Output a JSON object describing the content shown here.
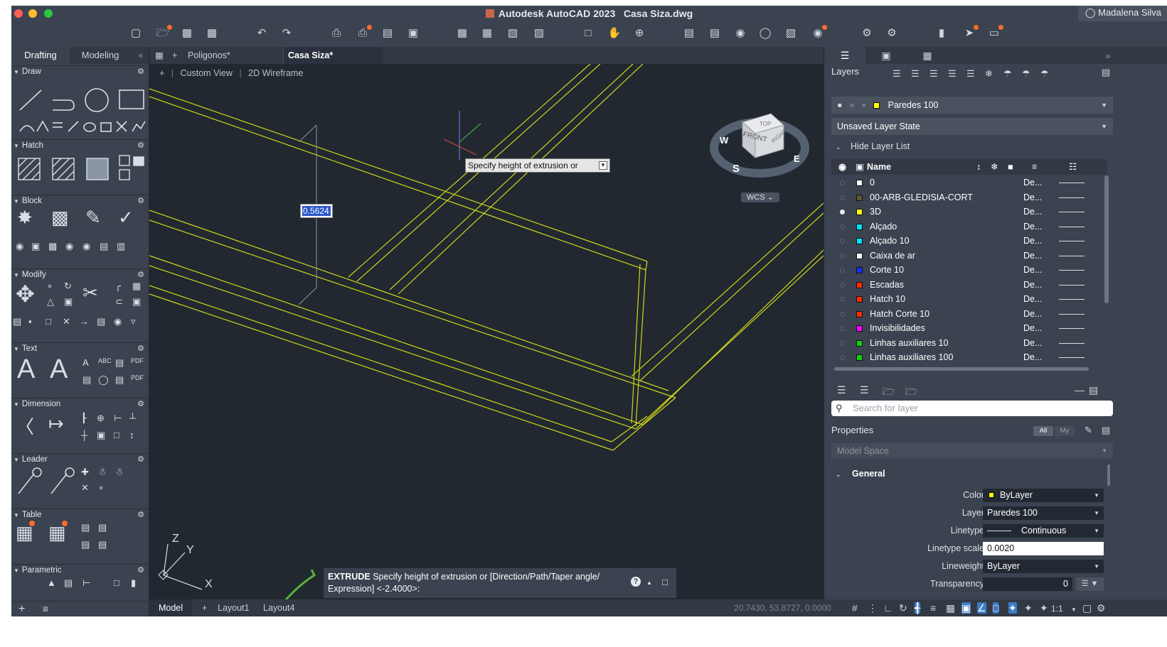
{
  "window": {
    "title_app": "Autodesk AutoCAD 2023",
    "title_doc": "Casa Siza.dwg",
    "user": "Madalena Silva"
  },
  "toolbar_icons": [
    "new-icon",
    "open-icon",
    "save-icon",
    "save-as-icon",
    "undo-icon",
    "redo-icon",
    "plot-icon",
    "batch-plot-icon",
    "publish-icon",
    "export-icon",
    "import-icon",
    "attach-icon",
    "share-icon",
    "zoom-window-icon",
    "pan-icon",
    "orbit-icon",
    "layer-properties-icon",
    "match-layer-icon",
    "layer-state-icon",
    "isolate-icon",
    "properties-icon",
    "design-center-icon",
    "tool-palette-icon",
    "sheet-set-icon",
    "compare-icon",
    "trace-icon",
    "cloud-icon"
  ],
  "left_palette": {
    "tabs": [
      "Drafting",
      "Modeling"
    ],
    "collapse": "«",
    "sections": [
      "Draw",
      "Hatch",
      "Block",
      "Modify",
      "Text",
      "Dimension",
      "Leader",
      "Table",
      "Parametric"
    ]
  },
  "doc_tabs": {
    "add": "+",
    "tabs": [
      "Poligonos*",
      "Casa Siza*"
    ]
  },
  "viewport": {
    "controls": "+",
    "view": "Custom View",
    "visual_style": "2D Wireframe",
    "dynamic_input_value": "0.5624",
    "tooltip": "Specify height of extrusion or",
    "viewcube": {
      "top": "TOP",
      "front": "FRONT",
      "right": "RIGHT",
      "n": "W",
      "s": "S",
      "e": "E"
    },
    "wcs": "WCS",
    "ucs": {
      "x": "X",
      "y": "Y",
      "z": "Z"
    }
  },
  "command_line": {
    "command": "EXTRUDE",
    "prompt_1": "Specify height of extrusion or [Direction/Path/Taper angle/",
    "prompt_2": "Expression] <-2.4000>:",
    "help": "?"
  },
  "status_bar": {
    "tabs": [
      "Model",
      "Layout1",
      "Layout4"
    ],
    "add": "+",
    "coords": "20.7430, 53.8727, 0.0000",
    "scale": "1:1"
  },
  "layers_panel": {
    "title": "Layers",
    "current_layer": "Paredes 100",
    "current_layer_color": "#ffff00",
    "layer_state": "Unsaved Layer State",
    "hide_list": "Hide Layer List",
    "column_name": "Name",
    "search_placeholder": "Search for layer",
    "layers": [
      {
        "name": "0",
        "color": "#ffffff",
        "current": false,
        "desc": "De..."
      },
      {
        "name": "00-ARB-GLEDISIA-CORT",
        "color": "#5a5a2a",
        "current": false,
        "desc": "De..."
      },
      {
        "name": "3D",
        "color": "#ffff00",
        "current": true,
        "desc": "De..."
      },
      {
        "name": "Alçado",
        "color": "#00e5ff",
        "current": false,
        "desc": "De..."
      },
      {
        "name": "Alçado 10",
        "color": "#00e5ff",
        "current": false,
        "desc": "De..."
      },
      {
        "name": "Caixa de ar",
        "color": "#ffffff",
        "current": false,
        "desc": "De..."
      },
      {
        "name": "Corte 10",
        "color": "#1030ff",
        "current": false,
        "desc": "De..."
      },
      {
        "name": "Escadas",
        "color": "#ff2a00",
        "current": false,
        "desc": "De..."
      },
      {
        "name": "Hatch 10",
        "color": "#ff2a00",
        "current": false,
        "desc": "De..."
      },
      {
        "name": "Hatch Corte 10",
        "color": "#ff2a00",
        "current": false,
        "desc": "De..."
      },
      {
        "name": "Invisibilidades",
        "color": "#ff00ff",
        "current": false,
        "desc": "De..."
      },
      {
        "name": "Linhas auxiliares 10",
        "color": "#10d010",
        "current": false,
        "desc": "De..."
      },
      {
        "name": "Linhas auxiliares 100",
        "color": "#10d010",
        "current": false,
        "desc": "De..."
      }
    ]
  },
  "properties_panel": {
    "title": "Properties",
    "filter_all": "All",
    "filter_my": "My",
    "space": "Model Space",
    "group": "General",
    "rows": [
      {
        "label": "Color",
        "value": "ByLayer"
      },
      {
        "label": "Layer",
        "value": "Paredes 100"
      },
      {
        "label": "Linetype",
        "value": "Continuous"
      },
      {
        "label": "Linetype scale",
        "value": "0.0020"
      },
      {
        "label": "Lineweight",
        "value": "ByLayer"
      },
      {
        "label": "Transparency",
        "value": "0"
      }
    ]
  }
}
